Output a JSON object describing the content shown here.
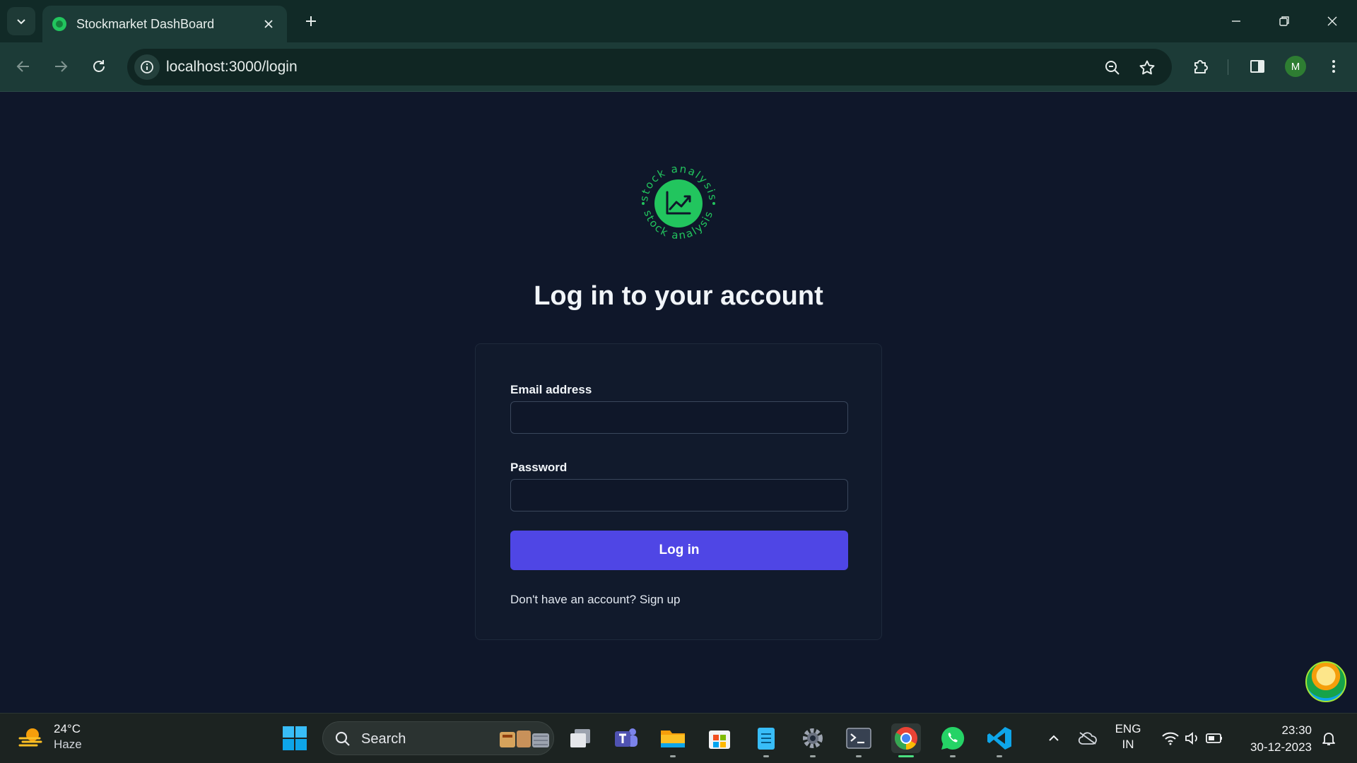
{
  "browser": {
    "tab_title": "Stockmarket DashBoard",
    "url": "localhost:3000/login",
    "profile_initial": "M"
  },
  "page": {
    "logo_text": "stock analysis",
    "heading": "Log in to your account",
    "email_label": "Email address",
    "email_value": "",
    "password_label": "Password",
    "password_value": "",
    "login_button": "Log in",
    "signup_prompt": "Don't have an account?",
    "signup_link": "Sign up"
  },
  "taskbar": {
    "weather_temp": "24°C",
    "weather_desc": "Haze",
    "search_placeholder": "Search",
    "language": "ENG",
    "region": "IN",
    "time": "23:30",
    "date": "30-12-2023"
  },
  "colors": {
    "page_bg": "#0f172a",
    "accent": "#4f46e5",
    "logo_green": "#22c55e"
  }
}
